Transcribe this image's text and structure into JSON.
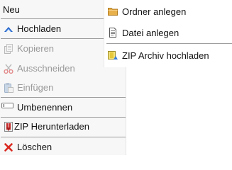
{
  "context_menu": {
    "items": [
      {
        "label": "Neu",
        "icon": "none",
        "disabled": false,
        "has_submenu": true,
        "highlighted": true
      },
      {
        "label": "Hochladen",
        "icon": "upload-chevron-icon",
        "disabled": false
      },
      {
        "label": "Kopieren",
        "icon": "copy-icon",
        "disabled": true
      },
      {
        "label": "Ausschneiden",
        "icon": "scissors-icon",
        "disabled": true
      },
      {
        "label": "Einfügen",
        "icon": "paste-icon",
        "disabled": true
      },
      {
        "label": "Umbenennen",
        "icon": "rename-field-icon",
        "disabled": false
      },
      {
        "label": "ZIP Herunterladen",
        "icon": "zip-download-icon",
        "disabled": false
      },
      {
        "label": "Löschen",
        "icon": "delete-x-icon",
        "disabled": false
      }
    ]
  },
  "submenu": {
    "parent": "Neu",
    "items": [
      {
        "label": "Ordner anlegen",
        "icon": "folder-icon"
      },
      {
        "label": "Datei anlegen",
        "icon": "file-icon"
      },
      {
        "label": "ZIP Archiv hochladen",
        "icon": "zip-upload-icon"
      }
    ]
  },
  "colors": {
    "menu_background": "#f7f7f7",
    "submenu_background": "#ffffff",
    "separator": "#9d9d9d",
    "disabled_text": "#9a9a9a",
    "upload_icon": "#1f5fc7",
    "delete_icon": "#d9281f",
    "folder_icon": "#e8b04a"
  }
}
